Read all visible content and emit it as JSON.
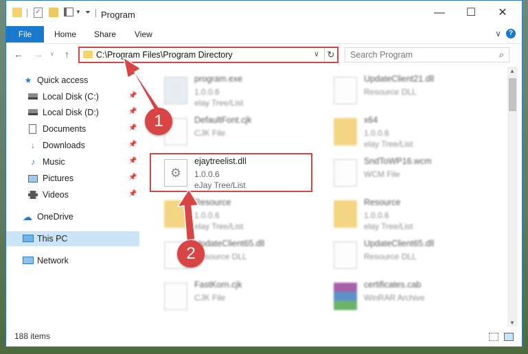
{
  "window": {
    "title": "Program",
    "controls": {
      "minimize": "—",
      "maximize": "☐",
      "close": "✕"
    }
  },
  "ribbon": {
    "tabs": [
      "File",
      "Home",
      "Share",
      "View"
    ],
    "help": "?"
  },
  "navbar": {
    "address": "C:\\Program Files\\Program Directory",
    "search_placeholder": "Search Program"
  },
  "sidebar": {
    "items": [
      {
        "label": "Quick access",
        "icon": "star-icon",
        "pinned": false
      },
      {
        "label": "Local Disk (C:)",
        "icon": "drive-icon",
        "pinned": true
      },
      {
        "label": "Local Disk (D:)",
        "icon": "drive-icon",
        "pinned": true
      },
      {
        "label": "Documents",
        "icon": "documents-icon",
        "pinned": true
      },
      {
        "label": "Downloads",
        "icon": "download-icon",
        "pinned": true
      },
      {
        "label": "Music",
        "icon": "music-icon",
        "pinned": true
      },
      {
        "label": "Pictures",
        "icon": "pictures-icon",
        "pinned": true
      },
      {
        "label": "Videos",
        "icon": "videos-icon",
        "pinned": true
      },
      {
        "label": "OneDrive",
        "icon": "cloud-icon",
        "pinned": false
      },
      {
        "label": "This PC",
        "icon": "computer-icon",
        "pinned": false,
        "selected": true
      },
      {
        "label": "Network",
        "icon": "network-icon",
        "pinned": false
      }
    ]
  },
  "files": [
    {
      "name": "program.exe",
      "meta1": "1.0.0.6",
      "meta2": "elay Tree/List",
      "icon": "exe-icon"
    },
    {
      "name": "UpdateClient21.dll",
      "meta1": "Resource DLL",
      "meta2": "",
      "icon": "dll-icon"
    },
    {
      "name": "DefaultFont.cjk",
      "meta1": "CJK File",
      "meta2": "",
      "icon": "document-icon"
    },
    {
      "name": "x64",
      "meta1": "1.0.0.6",
      "meta2": "elay Tree/List",
      "icon": "folder-icon"
    },
    {
      "name": "ejaytreelist.dll",
      "meta1": "1.0.0.6",
      "meta2": "eJay Tree/List",
      "icon": "dll-icon"
    },
    {
      "name": "SndToWP16.wcm",
      "meta1": "WCM File",
      "meta2": "",
      "icon": "document-icon"
    },
    {
      "name": "Resource",
      "meta1": "1.0.0.6",
      "meta2": "elay Tree/List",
      "icon": "folder-icon"
    },
    {
      "name": "Resource",
      "meta1": "1.0.0.6",
      "meta2": "elay Tree/List",
      "icon": "folder-icon"
    },
    {
      "name": "UpdateClient65.dll",
      "meta1": "Resource DLL",
      "meta2": "",
      "icon": "dll-icon"
    },
    {
      "name": "UpdateClient65.dll",
      "meta1": "Resource DLL",
      "meta2": "",
      "icon": "dll-icon"
    },
    {
      "name": "FastKorn.cjk",
      "meta1": "CJK File",
      "meta2": "",
      "icon": "document-icon"
    },
    {
      "name": "certificates.cab",
      "meta1": "WinRAR Archive",
      "meta2": "",
      "icon": "archive-icon"
    }
  ],
  "status": {
    "item_count": "188 items"
  },
  "annotations": {
    "step1": "1",
    "step2": "2"
  },
  "colors": {
    "accent": "#1979ca",
    "highlight": "#d94545",
    "selected": "#cce4f7"
  }
}
